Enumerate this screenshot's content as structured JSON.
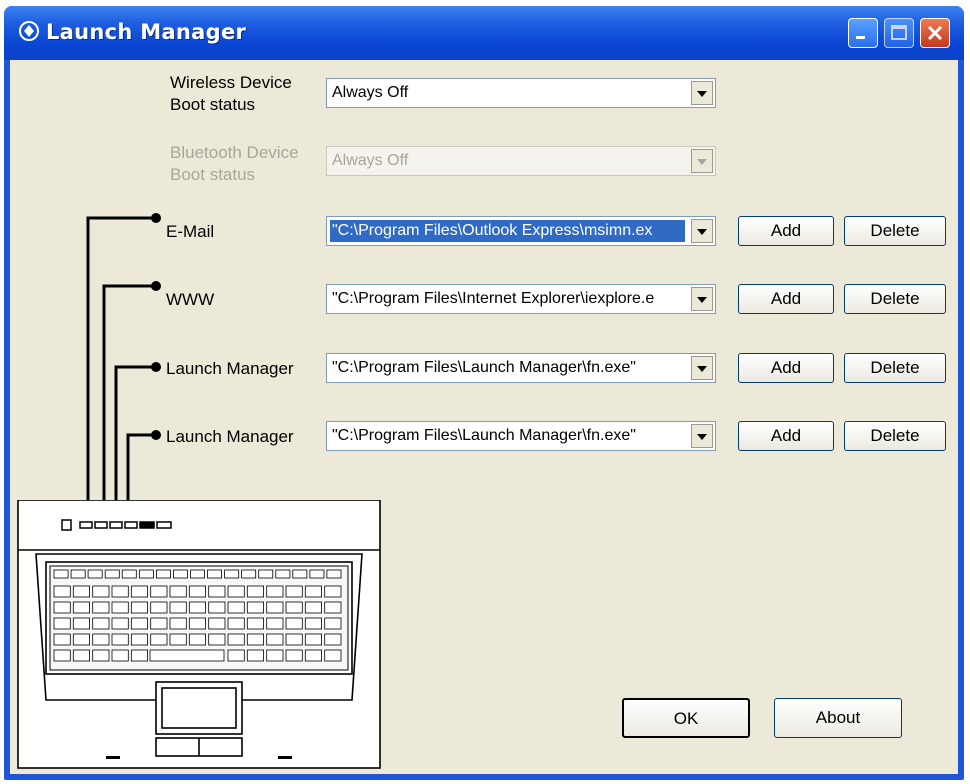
{
  "window": {
    "title": "Launch Manager"
  },
  "titlebar_buttons": {
    "minimize_icon": "minimize-icon",
    "maximize_icon": "maximize-icon",
    "close_icon": "close-icon"
  },
  "wireless": {
    "label_line1": "Wireless Device",
    "label_line2": "Boot status",
    "value": "Always Off"
  },
  "bluetooth": {
    "label_line1": "Bluetooth Device",
    "label_line2": "Boot status",
    "value": "Always Off",
    "enabled": false
  },
  "launch_rows": [
    {
      "label": "E-Mail",
      "value": "\"C:\\Program Files\\Outlook Express\\msimn.ex",
      "selected": true,
      "add": "Add",
      "delete": "Delete"
    },
    {
      "label": "WWW",
      "value": "\"C:\\Program Files\\Internet Explorer\\iexplore.e",
      "selected": false,
      "add": "Add",
      "delete": "Delete"
    },
    {
      "label": "Launch Manager",
      "value": "\"C:\\Program Files\\Launch Manager\\fn.exe\"",
      "selected": false,
      "add": "Add",
      "delete": "Delete"
    },
    {
      "label": "Launch Manager",
      "value": "\"C:\\Program Files\\Launch Manager\\fn.exe\"",
      "selected": false,
      "add": "Add",
      "delete": "Delete"
    }
  ],
  "footer": {
    "ok": "OK",
    "about": "About"
  },
  "colors": {
    "titlebar": "#0a46d4",
    "client_bg": "#ece9d8",
    "selection": "#316ac5",
    "close_button": "#c4371e"
  }
}
